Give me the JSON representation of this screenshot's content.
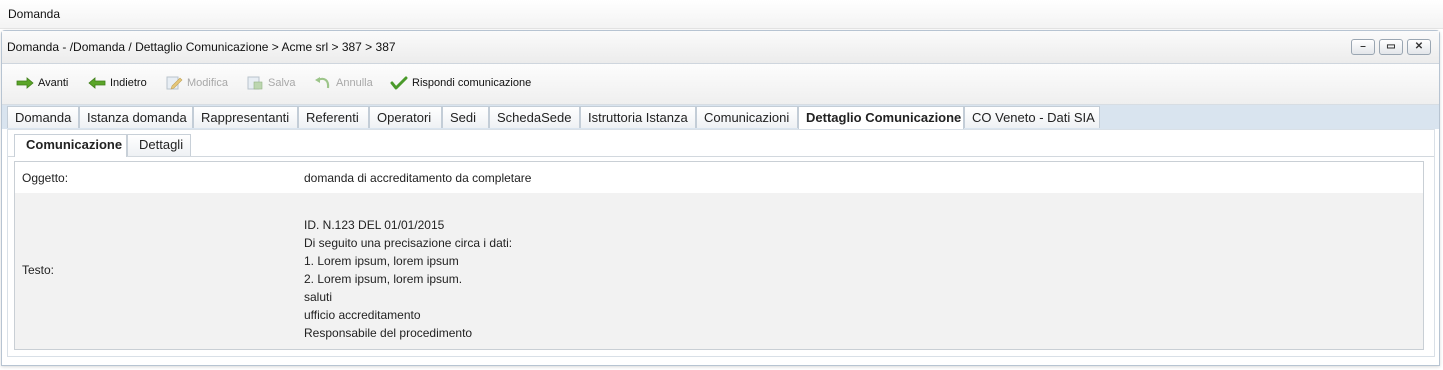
{
  "page_title": "Domanda",
  "window": {
    "title": "Domanda - /Domanda / Dettaglio Comunicazione > Acme srl > 387 > 387",
    "controls": [
      "minimize",
      "maximize",
      "close"
    ]
  },
  "toolbar": {
    "avanti": "Avanti",
    "indietro": "Indietro",
    "modifica": "Modifica",
    "salva": "Salva",
    "annulla": "Annulla",
    "rispondi": "Rispondi comunicazione"
  },
  "tabs": [
    "Domanda",
    "Istanza domanda",
    "Rappresentanti",
    "Referenti",
    "Operatori",
    "Sedi",
    "SchedaSede",
    "Istruttoria Istanza",
    "Comunicazioni",
    "Dettaglio Comunicazione",
    "CO Veneto - Dati SIA"
  ],
  "active_tab": "Dettaglio Comunicazione",
  "subtabs": [
    "Comunicazione",
    "Dettagli"
  ],
  "active_subtab": "Comunicazione",
  "detail": {
    "oggetto_label": "Oggetto:",
    "oggetto_value": "domanda di accreditamento da completare",
    "testo_label": "Testo:",
    "testo_lines": [
      "ID. N.123 DEL 01/01/2015",
      "Di seguito una precisazione circa i dati:",
      "1. Lorem ipsum, lorem ipsum",
      "2. Lorem ipsum, lorem ipsum.",
      "saluti",
      "ufficio accreditamento",
      "Responsabile del procedimento"
    ]
  },
  "colors": {
    "tab_strip": "#d9e4ef",
    "arrow_green": "#5aa528",
    "check_green": "#4a9a2a"
  }
}
